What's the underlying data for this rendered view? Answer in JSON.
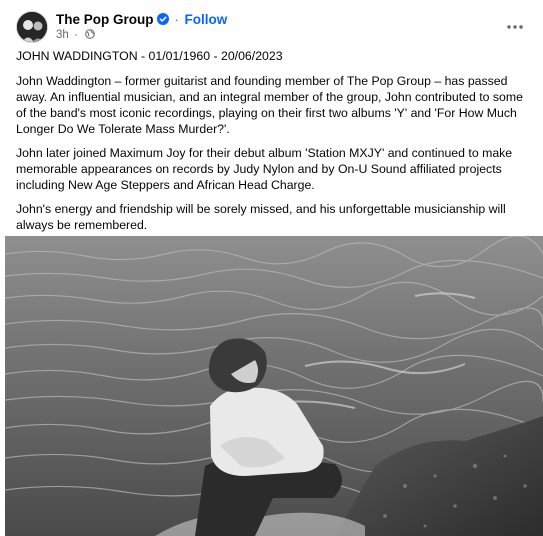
{
  "post": {
    "page_name": "The Pop Group",
    "follow_label": "Follow",
    "separator": "·",
    "time": "3h",
    "title": "JOHN WADDINGTON - 01/01/1960 - 20/06/2023",
    "paragraphs": [
      "John Waddington – former guitarist and founding member of The Pop Group – has passed away. An influential musician, and an integral member of the group, John contributed to some of the band's most iconic recordings, playing on their first two albums 'Y' and 'For How Much Longer Do We Tolerate Mass Murder?'.",
      "John later joined Maximum Joy for their debut album 'Station MXJY' and continued to make memorable appearances on records by Judy Nylon and by On-U Sound affiliated projects including New Age Steppers and African Head Charge.",
      "John's energy and friendship will be sorely missed, and his unforgettable musicianship will always be remembered."
    ]
  },
  "icons": {
    "verified": "verified-badge-icon",
    "privacy": "globe-icon",
    "more": "more-options-icon"
  },
  "colors": {
    "link": "#0866ff",
    "secondary_text": "#65676b",
    "primary_text": "#050505"
  }
}
